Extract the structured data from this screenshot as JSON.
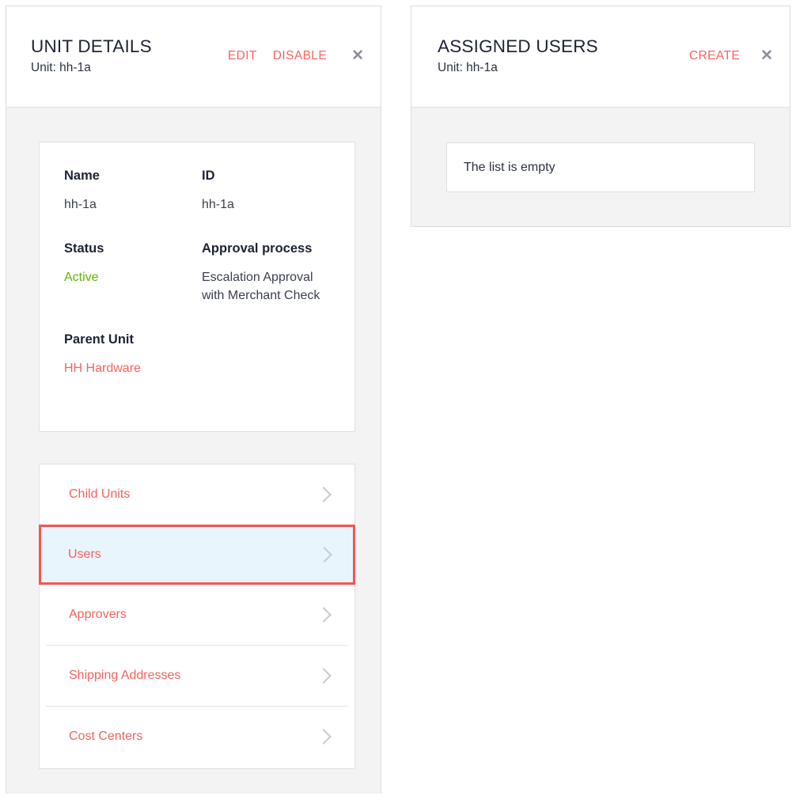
{
  "theme": {
    "accent_red": "#f9635f",
    "highlight_border": "#f4554f",
    "highlight_fill": "#e9f5fd",
    "status_green": "#5cb800",
    "panel_bg": "#f3f3f3",
    "card_bg": "#ffffff",
    "text_dark": "#1d2333",
    "chevron_gray": "#c7c9d1"
  },
  "unit_details_panel": {
    "title": "UNIT DETAILS",
    "subtitle": "Unit: hh-1a",
    "actions": {
      "edit_label": "EDIT",
      "disable_label": "DISABLE",
      "close_glyph": "✕"
    },
    "detail_card": {
      "fields": [
        {
          "label": "Name",
          "value": "hh-1a",
          "kind": "text"
        },
        {
          "label": "ID",
          "value": "hh-1a",
          "kind": "text"
        },
        {
          "label": "Status",
          "value": "Active",
          "kind": "status"
        },
        {
          "label": "Approval process",
          "value": "Escalation Approval with Merchant Check",
          "kind": "text"
        },
        {
          "label": "Parent Unit",
          "value": "HH Hardware",
          "kind": "link"
        }
      ]
    },
    "nav_list": {
      "items": [
        {
          "label": "Child Units",
          "highlighted": false,
          "chevron": "chevron-right-icon"
        },
        {
          "label": "Users",
          "highlighted": true,
          "chevron": "chevron-right-icon"
        },
        {
          "label": "Approvers",
          "highlighted": false,
          "chevron": "chevron-right-icon"
        },
        {
          "label": "Shipping Addresses",
          "highlighted": false,
          "chevron": "chevron-right-icon"
        },
        {
          "label": "Cost Centers",
          "highlighted": false,
          "chevron": "chevron-right-icon"
        }
      ]
    }
  },
  "assigned_users_panel": {
    "title": "ASSIGNED USERS",
    "subtitle": "Unit: hh-1a",
    "actions": {
      "create_label": "CREATE",
      "close_glyph": "✕"
    },
    "empty_state_text": "The list is empty"
  }
}
